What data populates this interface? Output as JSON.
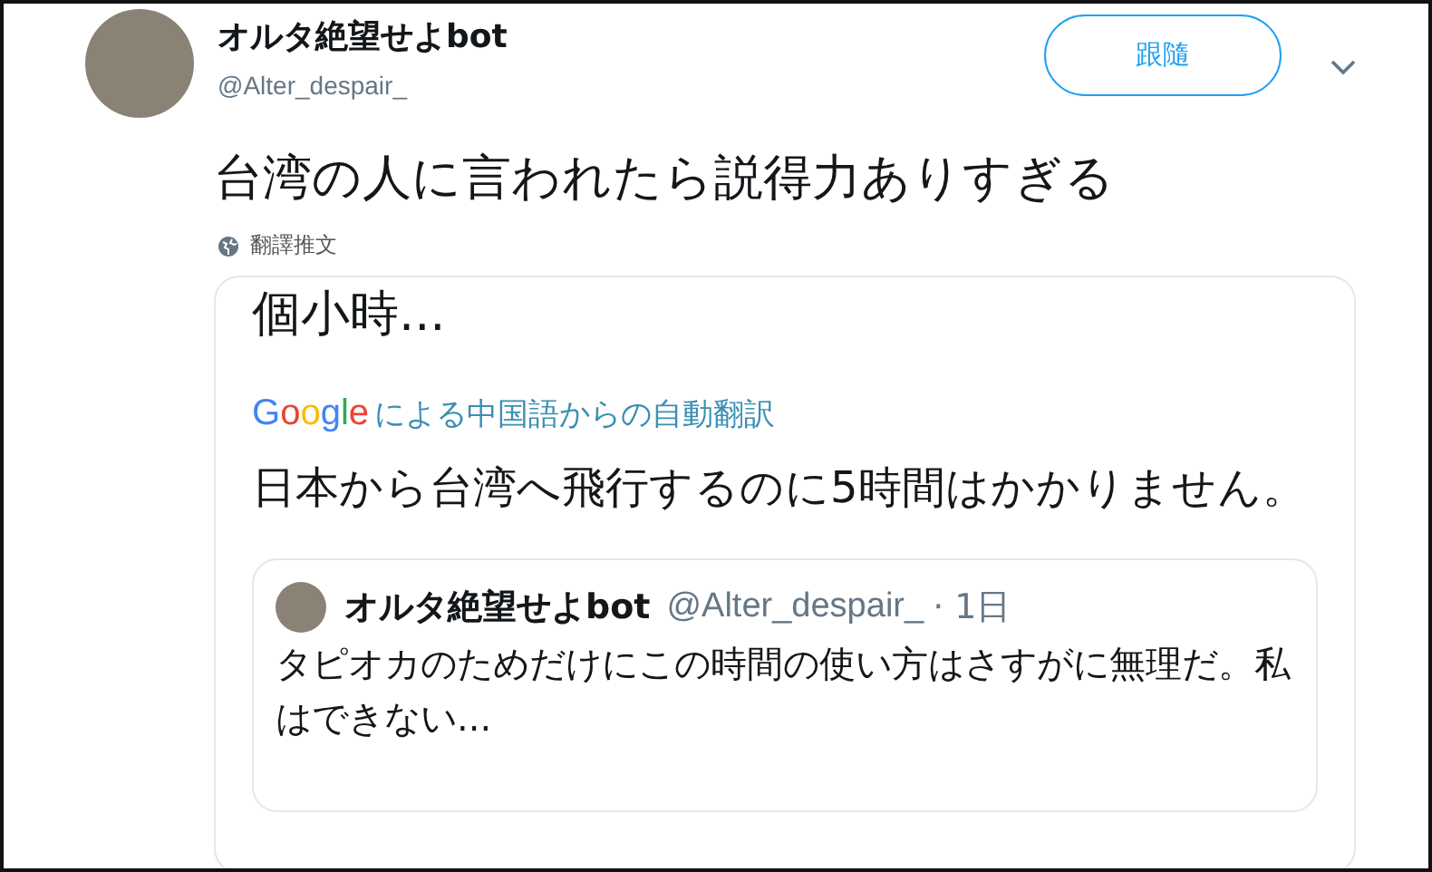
{
  "tweet": {
    "author": {
      "name": "オルタ絶望せよbot",
      "handle": "@Alter_despair_"
    },
    "follow_button": "跟隨",
    "text": "台湾の人に言われたら説得力ありすぎる",
    "translate_link": "翻譯推文",
    "image": {
      "top_text": "個小時...",
      "translation_brand": "Google",
      "translation_label": "による中国語からの自動翻訳",
      "translated_text": "日本から台湾へ飛行するのに5時間はかかりません。",
      "quote": {
        "name": "オルタ絶望せよbot",
        "handle": "@Alter_despair_",
        "time": "· 1日",
        "text": "タピオカのためだけにこの時間の使い方はさすがに無理だ。私はできない..."
      }
    }
  }
}
